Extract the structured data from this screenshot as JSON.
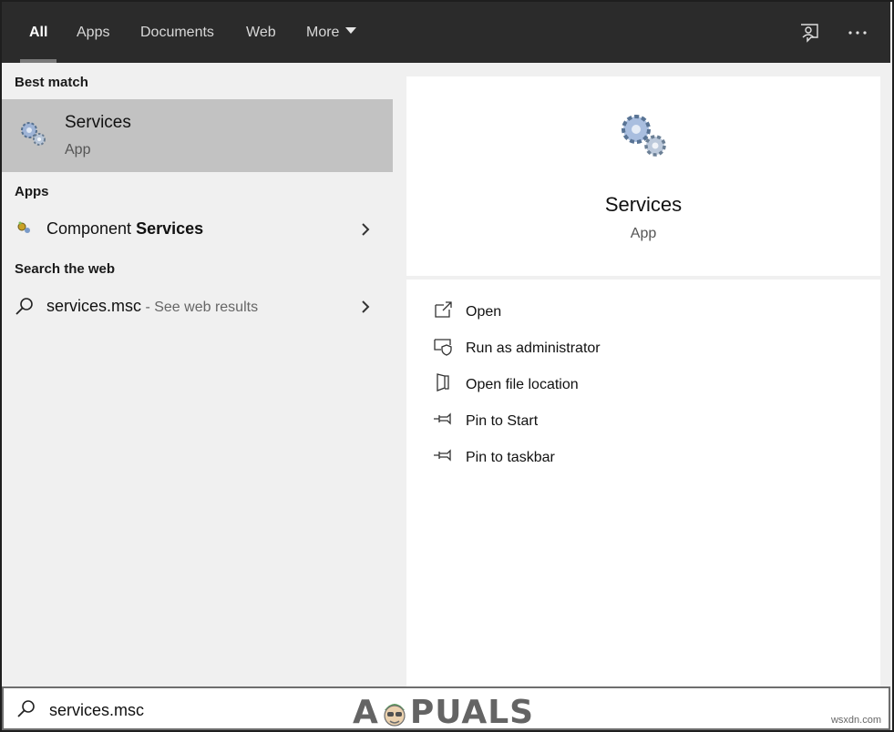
{
  "tabs": [
    {
      "label": "All",
      "active": true
    },
    {
      "label": "Apps"
    },
    {
      "label": "Documents"
    },
    {
      "label": "Web"
    },
    {
      "label": "More"
    }
  ],
  "top_icons": [
    "feedback-icon",
    "more-options-icon"
  ],
  "sections": {
    "best_match": "Best match",
    "apps": "Apps",
    "search_web": "Search the web"
  },
  "best_match": {
    "title": "Services",
    "subtitle": "App",
    "icon": "gears-icon"
  },
  "apps": [
    {
      "label_prefix": "Component ",
      "label_bold": "Services",
      "icon": "component-services-icon"
    }
  ],
  "web_results": [
    {
      "query": "services.msc",
      "suffix": " - See web results",
      "icon": "search-icon"
    }
  ],
  "detail": {
    "title": "Services",
    "subtitle": "App",
    "actions": [
      {
        "label": "Open",
        "icon": "open-icon"
      },
      {
        "label": "Run as administrator",
        "icon": "shield-icon"
      },
      {
        "label": "Open file location",
        "icon": "file-location-icon"
      },
      {
        "label": "Pin to Start",
        "icon": "pin-icon"
      },
      {
        "label": "Pin to taskbar",
        "icon": "pin-icon"
      }
    ]
  },
  "search": {
    "value": "services.msc"
  },
  "watermark": {
    "text_a": "A",
    "text_b": "PUALS"
  },
  "credit": "wsxdn.com",
  "colors": {
    "topbar": "#2b2b2b",
    "selected": "#c2c2c2",
    "pane": "#f0f0f0"
  }
}
